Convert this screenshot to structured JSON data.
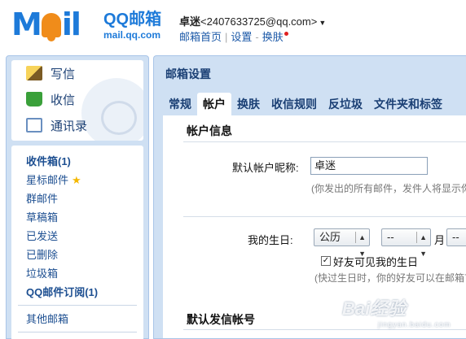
{
  "header": {
    "logo_text": "MOil",
    "logo_cn": "QQ邮箱",
    "logo_url": "mail.qq.com",
    "user_name": "卓迷",
    "user_email": "<2407633725@qq.com>",
    "links": [
      "邮箱首页",
      "设置",
      "换肤"
    ]
  },
  "sidebar": {
    "quick": [
      {
        "label": "写信",
        "icon": "write-icon"
      },
      {
        "label": "收信",
        "icon": "inbox-download-icon"
      },
      {
        "label": "通讯录",
        "icon": "contacts-icon"
      }
    ],
    "folders": [
      {
        "label": "收件箱(1)",
        "bold": true
      },
      {
        "label": "星标邮件",
        "star": true
      },
      {
        "label": "群邮件"
      },
      {
        "label": "草稿箱"
      },
      {
        "label": "已发送"
      },
      {
        "label": "已删除"
      },
      {
        "label": "垃圾箱"
      },
      {
        "label": "QQ邮件订阅(1)",
        "bold": true
      }
    ],
    "other": "其他邮箱"
  },
  "main": {
    "title": "邮箱设置",
    "tabs": [
      "常规",
      "帐户",
      "换肤",
      "收信规则",
      "反垃圾",
      "文件夹和标签"
    ],
    "active_tab": 1,
    "account_section": "帐户信息",
    "nickname_label": "默认帐户昵称:",
    "nickname_value": "卓迷",
    "nickname_hint": "(你发出的所有邮件，发件人将显示你的昵称)",
    "birthday_label": "我的生日:",
    "calendar_value": "公历",
    "month_value": "--",
    "month_unit": "月",
    "day_value": "--",
    "friends_see_label": "好友可见我的生日",
    "friends_see_checked": true,
    "birthday_hint": "(快过生日时，你的好友可以在邮箱首页看到提醒)",
    "sender_section": "默认发信帐号"
  },
  "watermark": {
    "text": "Bai经验",
    "sub": "jingyan.baidu.com"
  }
}
